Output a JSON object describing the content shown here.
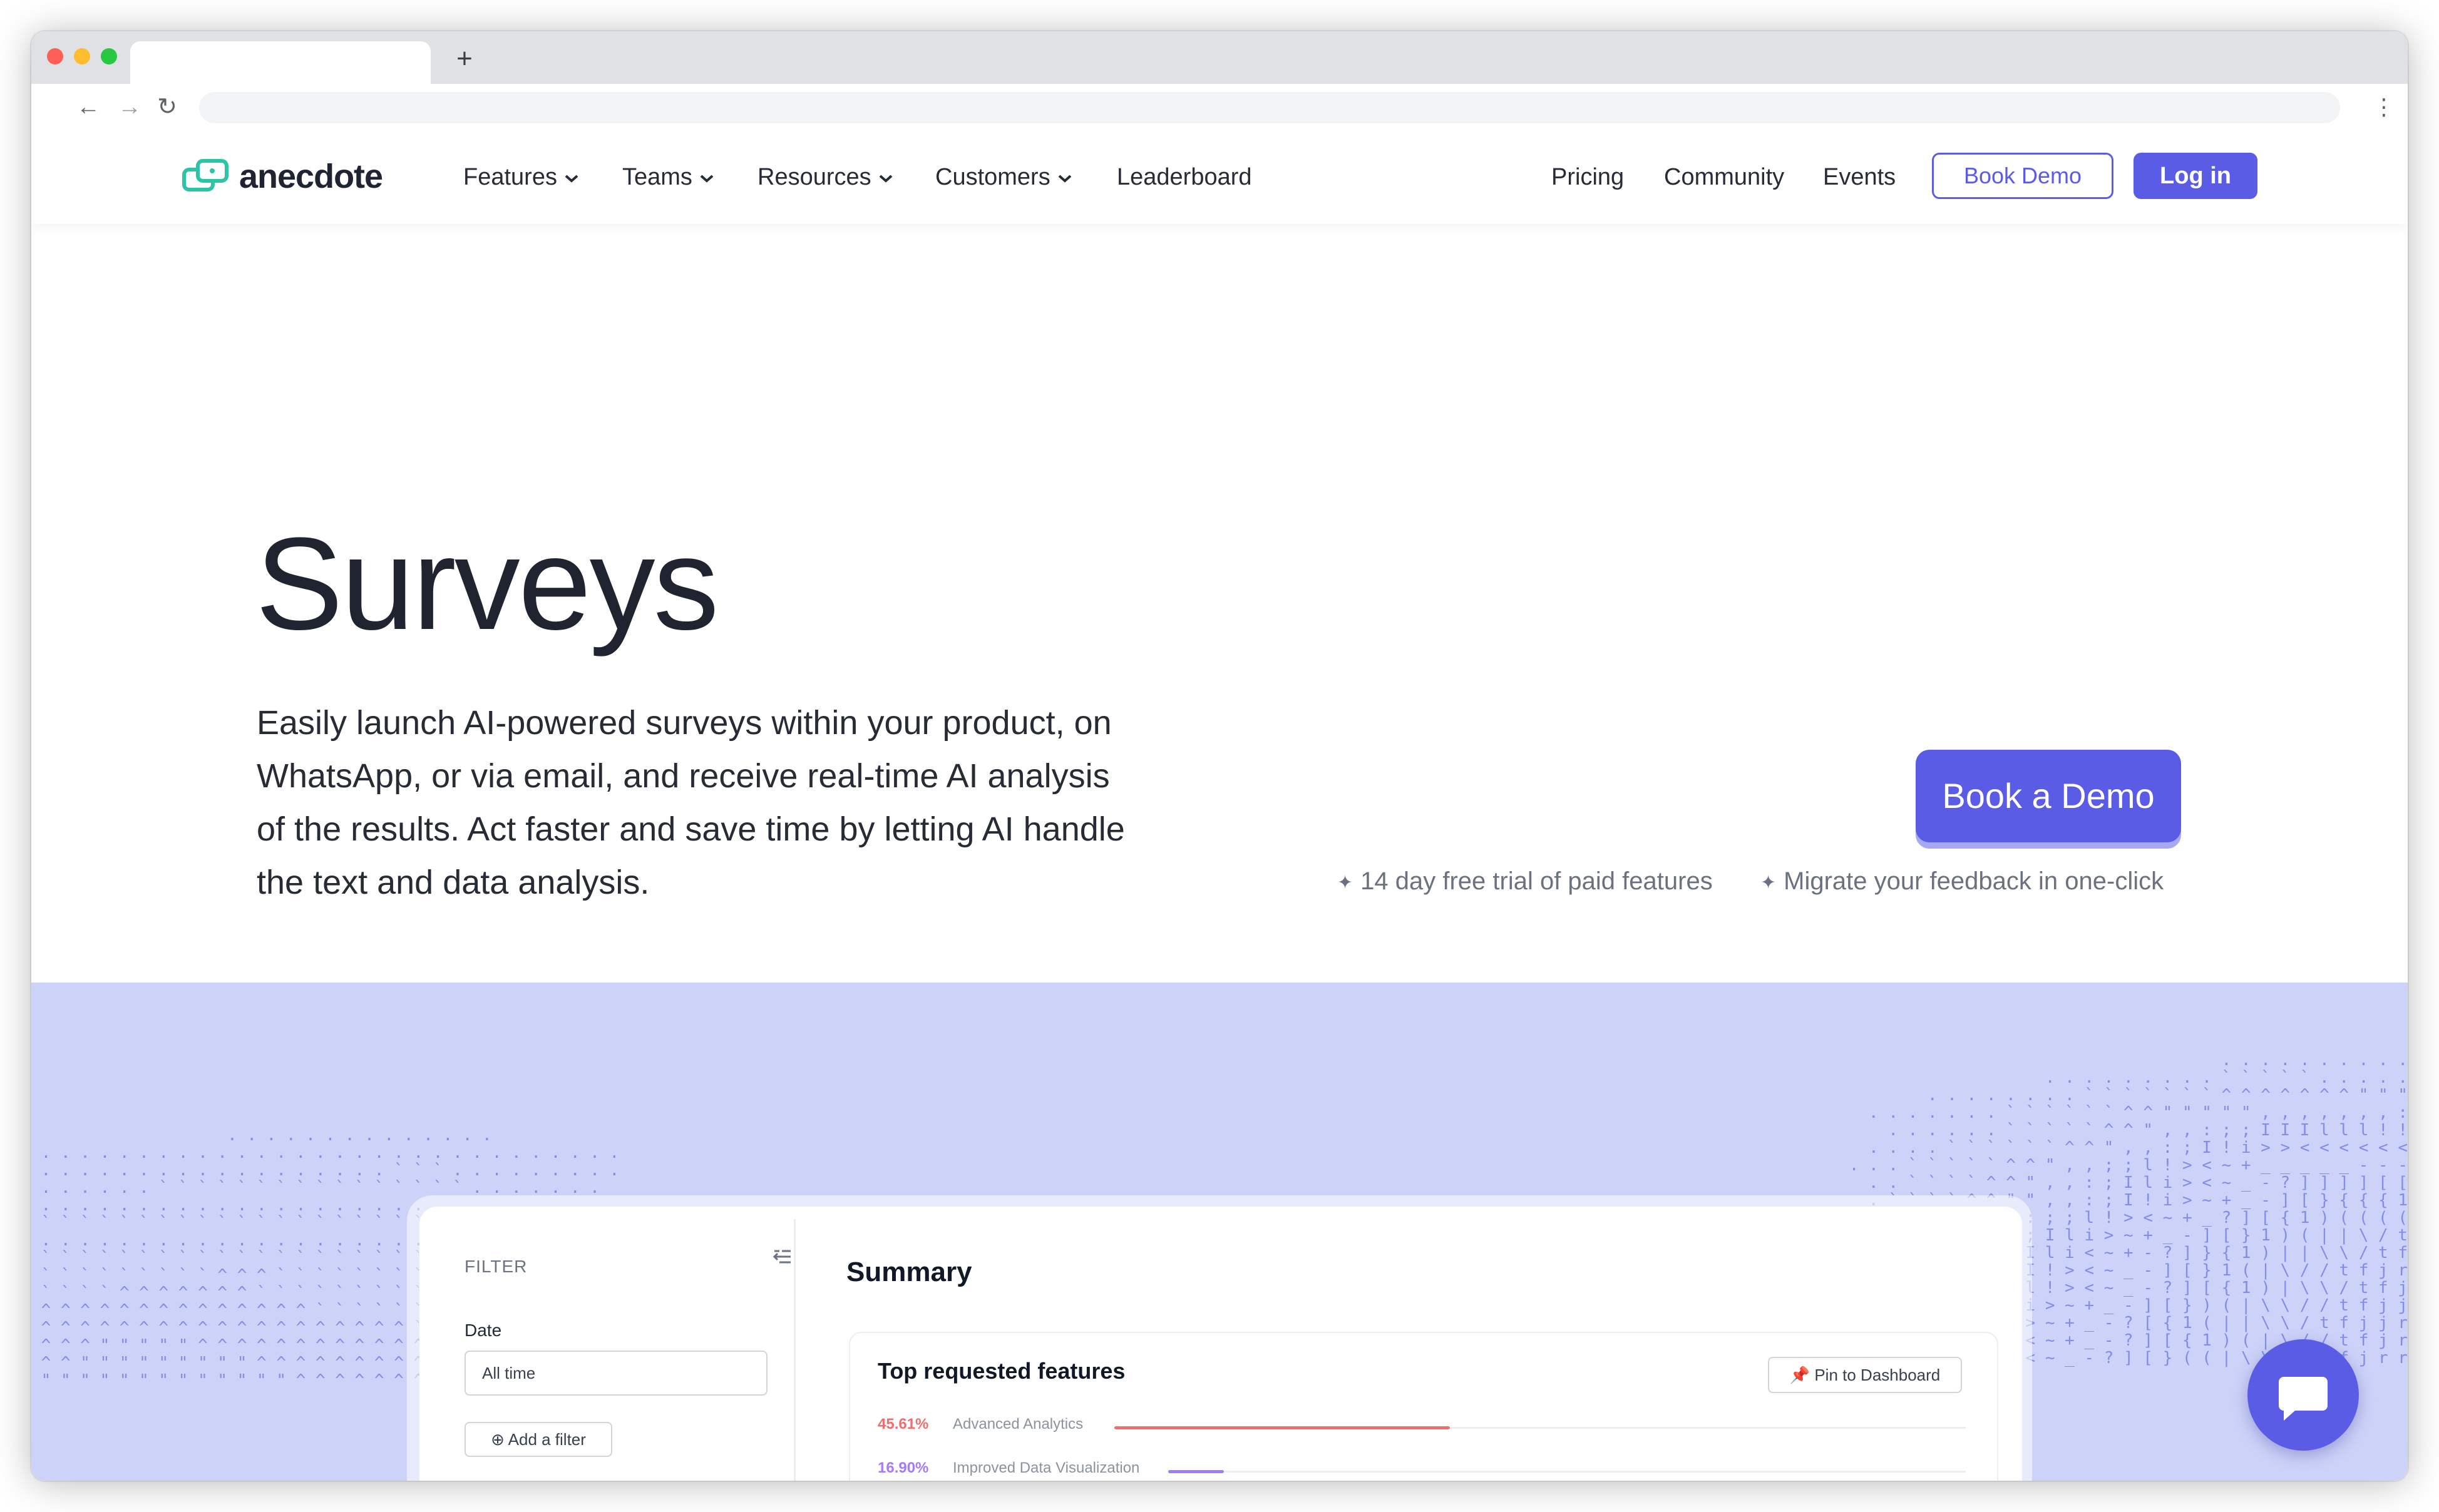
{
  "browser": {
    "new_tab_glyph": "+",
    "back_glyph": "←",
    "forward_glyph": "→",
    "reload_glyph": "↻",
    "menu_glyph": "⋮"
  },
  "nav": {
    "logo_text": "anecdote",
    "menu": [
      {
        "label": "Features"
      },
      {
        "label": "Teams"
      },
      {
        "label": "Resources"
      },
      {
        "label": "Customers"
      },
      {
        "label": "Leaderboard"
      }
    ],
    "right_links": [
      {
        "label": "Pricing"
      },
      {
        "label": "Community"
      },
      {
        "label": "Events"
      }
    ],
    "book_demo_label": "Book Demo",
    "login_label": "Log in"
  },
  "hero": {
    "title": "Surveys",
    "description": "Easily launch AI-powered surveys within your product, on WhatsApp, or via email, and receive real-time AI analysis of the results. Act faster and save time by letting AI handle the text and data analysis.",
    "cta_label": "Book a Demo",
    "notes": [
      "14 day free trial of paid features",
      "Migrate your feedback in one-click"
    ]
  },
  "dashboard": {
    "filter_label": "FILTER",
    "date_label": "Date",
    "date_value": "All time",
    "add_filter_label": "Add a filter",
    "summary_title": "Summary",
    "card_title": "Top requested features",
    "pin_label": "Pin to Dashboard",
    "rows": [
      {
        "pct": "45.61%",
        "label": "Advanced Analytics",
        "value": 45.61,
        "color": "#f26d6d"
      },
      {
        "pct": "16.90%",
        "label": "Improved Data Visualization",
        "value": 16.9,
        "color": "#a77bf3"
      }
    ]
  },
  "colors": {
    "brand": "#5b5ce6",
    "logo_accent": "#2cc4a6",
    "band": "#cdd2f8"
  }
}
